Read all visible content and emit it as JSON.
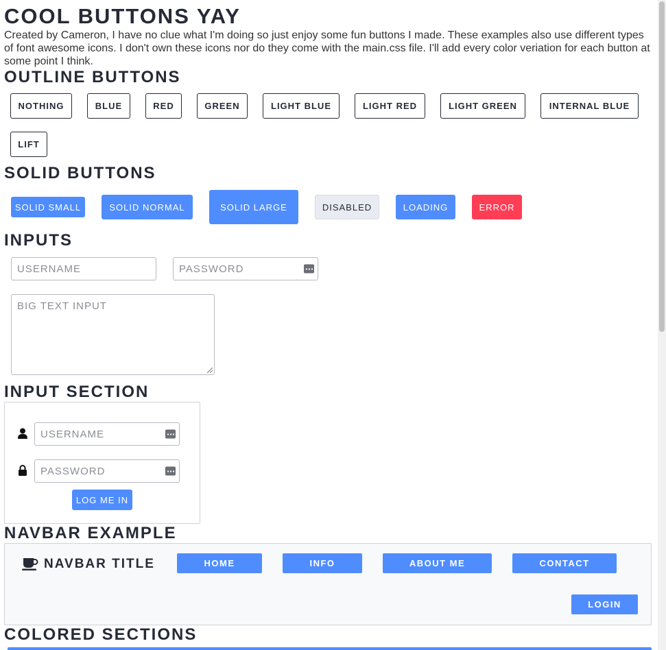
{
  "page": {
    "title": "COOL BUTTONS YAY",
    "intro": "Created by Cameron, I have no clue what I'm doing so just enjoy some fun buttons I made. These examples also use different types of font awesome icons. I don't own these icons nor do they come with the main.css file. I'll add every color veriation for each button at some point I think."
  },
  "outline": {
    "heading": "OUTLINE BUTTONS",
    "buttons": [
      "NOTHING",
      "BLUE",
      "RED",
      "GREEN",
      "LIGHT BLUE",
      "LIGHT RED",
      "LIGHT GREEN",
      "INTERNAL BLUE",
      "LIFT"
    ]
  },
  "solid": {
    "heading": "SOLID BUTTONS",
    "buttons": [
      "SOLID SMALL",
      "SOLID NORMAL",
      "SOLID LARGE",
      "DISABLED",
      "LOADING",
      "ERROR"
    ]
  },
  "inputs": {
    "heading": "INPUTS",
    "username_placeholder": "USERNAME",
    "password_placeholder": "PASSWORD",
    "textarea_placeholder": "BIG TEXT INPUT"
  },
  "input_section": {
    "heading": "INPUT SECTION",
    "username_placeholder": "USERNAME",
    "password_placeholder": "PASSWORD",
    "login_label": "LOG ME IN"
  },
  "navbar": {
    "heading": "NAVBAR EXAMPLE",
    "title": "NAVBAR TITLE",
    "links": [
      "HOME",
      "INFO",
      "ABOUT ME",
      "CONTACT"
    ],
    "login_label": "LOGIN"
  },
  "colored": {
    "heading": "COLORED SECTIONS"
  },
  "colors": {
    "accent": "#4f8dff",
    "error": "#ff3d55",
    "text": "#262a36"
  },
  "icons": [
    "user-icon",
    "lock-icon",
    "coffee-icon",
    "password-manager-icon"
  ]
}
